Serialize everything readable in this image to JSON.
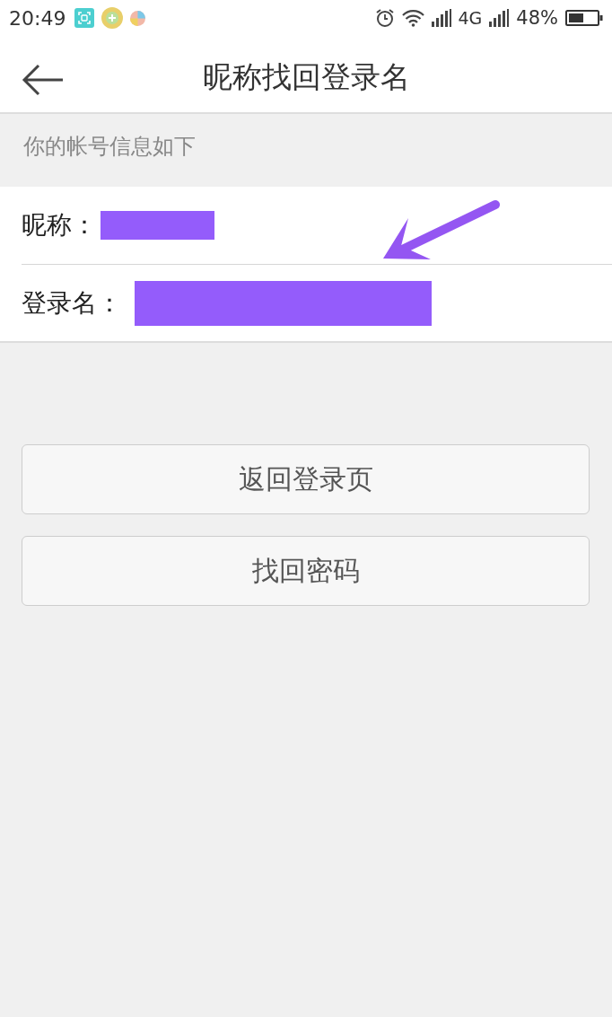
{
  "status_bar": {
    "time": "20:49",
    "network": "4G",
    "battery": "48%"
  },
  "header": {
    "title": "昵称找回登录名"
  },
  "info": {
    "heading": "你的帐号信息如下",
    "fields": [
      {
        "label": "昵称："
      },
      {
        "label": "登录名："
      }
    ]
  },
  "buttons": [
    {
      "label": "返回登录页"
    },
    {
      "label": "找回密码"
    }
  ]
}
